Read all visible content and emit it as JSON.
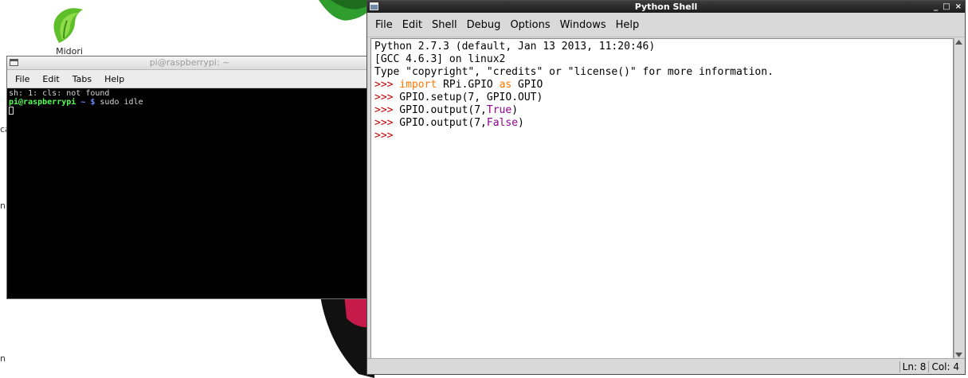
{
  "desktop": {
    "midori_label": "Midori",
    "edge_fragment_1": "ca",
    "edge_fragment_2": "n",
    "edge_fragment_3": "n",
    "accent_green": "#2f9e2f",
    "accent_red": "#c51a4a"
  },
  "terminal": {
    "title": "pi@raspberrypi: ~",
    "menu": [
      "File",
      "Edit",
      "Tabs",
      "Help"
    ],
    "lines": {
      "line1": "sh: 1: cls: not found",
      "prompt_user": "pi@raspberrypi",
      "prompt_path": " ~ $",
      "command": " sudo idle"
    }
  },
  "python_shell": {
    "title": "Python Shell",
    "window_controls": [
      "_",
      "□",
      "×"
    ],
    "menu": [
      "File",
      "Edit",
      "Shell",
      "Debug",
      "Options",
      "Windows",
      "Help"
    ],
    "banner": [
      "Python 2.7.3 (default, Jan 13 2013, 11:20:46)",
      "[GCC 4.6.3] on linux2",
      "Type \"copyright\", \"credits\" or \"license()\" for more information."
    ],
    "prompt": ">>>",
    "commands": {
      "c1_kw1": "import",
      "c1_mid": " RPi.GPIO ",
      "c1_kw2": "as",
      "c1_end": " GPIO",
      "c2": " GPIO.setup(7, GPIO.OUT)",
      "c3_pre": " GPIO.output(7,",
      "c3_val": "True",
      "c3_post": ")",
      "c4_pre": " GPIO.output(7,",
      "c4_val": "False",
      "c4_post": ")"
    },
    "status": {
      "line": "Ln: 8",
      "col": "Col: 4"
    },
    "colors": {
      "prompt": "#c00000",
      "keyword": "#ff7700",
      "builtin": "#900090"
    }
  }
}
